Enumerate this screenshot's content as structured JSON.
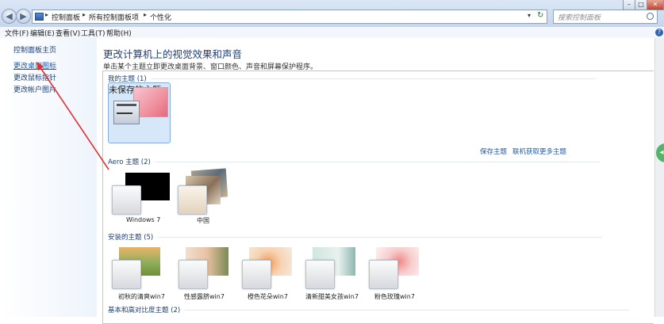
{
  "address_bar": {
    "breadcrumbs": [
      "控制面板",
      "所有控制面板项",
      "个性化"
    ],
    "refresh_symbol": "↻"
  },
  "search": {
    "placeholder": "搜索控制面板"
  },
  "window_controls": {
    "minimize": "–",
    "maximize": "□",
    "close": "✕"
  },
  "menu": {
    "items": [
      "文件(F)",
      "编辑(E)",
      "查看(V)",
      "工具(T)",
      "帮助(H)"
    ]
  },
  "sidebar": {
    "items": [
      "控制面板主页",
      "更改桌面图标",
      "更改鼠标指针",
      "更改帐户图片"
    ]
  },
  "main": {
    "title": "更改计算机上的视觉效果和声音",
    "subtitle": "单击某个主题立即更改桌面背景、窗口颜色、声音和屏幕保护程序。",
    "save_theme": "保存主题",
    "get_more_themes": "联机获取更多主题",
    "groups": {
      "my_themes": "我的主题 (1)",
      "aero_themes": "Aero 主题 (2)",
      "installed_themes": "安装的主题 (5)",
      "basic_themes": "基本和高对比度主题 (2)"
    },
    "my_themes": [
      {
        "label": "未保存的主题"
      }
    ],
    "aero_themes": [
      {
        "label": "Windows 7"
      },
      {
        "label": "中国"
      }
    ],
    "installed_themes": [
      {
        "label": "初秋的清爽win7"
      },
      {
        "label": "性感露脐win7"
      },
      {
        "label": "橙色花朵win7"
      },
      {
        "label": "清新甜美女孩win7"
      },
      {
        "label": "粉色玫瑰win7"
      }
    ]
  },
  "colors": {
    "accent": "#1f3e78",
    "link": "#1f5aa8",
    "selection": "#d6e7fa",
    "annotation_arrow": "#e03030"
  }
}
